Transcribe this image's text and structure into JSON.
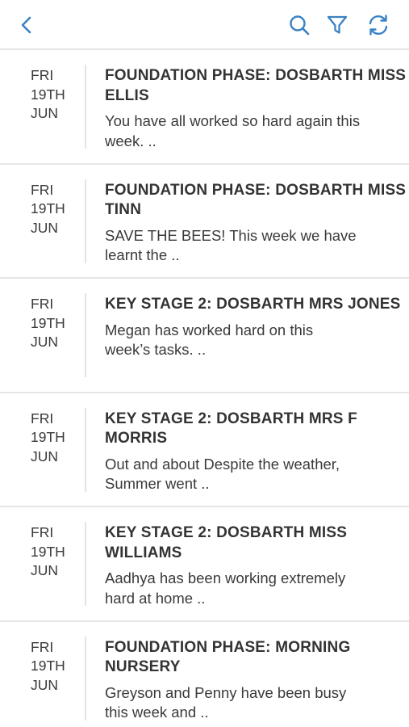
{
  "toolbar": {
    "back_icon": "chevron-left-icon",
    "search_icon": "search-icon",
    "filter_icon": "filter-icon",
    "refresh_icon": "refresh-icon",
    "accent_color": "#3b82c4"
  },
  "items": [
    {
      "day": "FRI",
      "date": "19TH",
      "month": "JUN",
      "title": "FOUNDATION PHASE: DOSBARTH MISS ELLIS",
      "preview": "You have all worked so hard again this week. .."
    },
    {
      "day": "FRI",
      "date": "19TH",
      "month": "JUN",
      "title": "FOUNDATION PHASE: DOSBARTH MISS TINN",
      "preview": "SAVE THE BEES!  This week we have learnt the .."
    },
    {
      "day": "FRI",
      "date": "19TH",
      "month": "JUN",
      "title": "KEY STAGE 2: DOSBARTH MRS JONES",
      "preview": "Megan has worked hard on this week’s tasks. .."
    },
    {
      "day": "FRI",
      "date": "19TH",
      "month": "JUN",
      "title": "KEY STAGE 2: DOSBARTH MRS F MORRIS",
      "preview": "Out and about Despite the weather, Summer went .."
    },
    {
      "day": "FRI",
      "date": "19TH",
      "month": "JUN",
      "title": "KEY STAGE 2: DOSBARTH MISS WILLIAMS",
      "preview": "Aadhya has been working extremely hard at home .."
    },
    {
      "day": "FRI",
      "date": "19TH",
      "month": "JUN",
      "title": "FOUNDATION PHASE: MORNING NURSERY",
      "preview": "Greyson and Penny have been busy this week and .."
    }
  ]
}
